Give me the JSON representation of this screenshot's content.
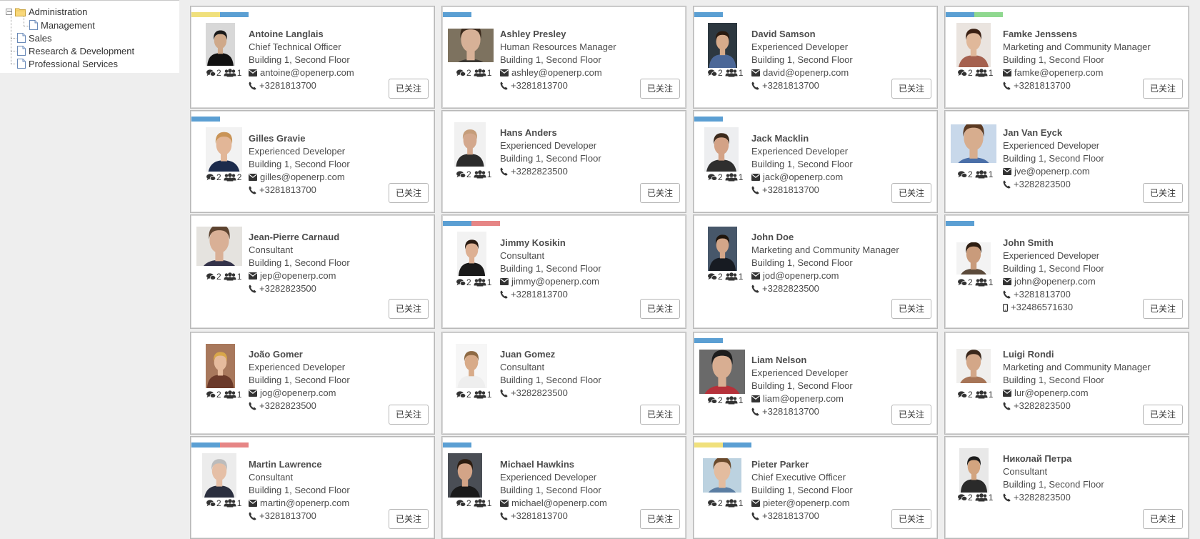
{
  "tree": {
    "root": {
      "label": "Administration",
      "toggle": "−"
    },
    "children": [
      {
        "label": "Management",
        "level": 2
      },
      {
        "label": "Sales",
        "level": 1
      },
      {
        "label": "Research & Development",
        "level": 1
      },
      {
        "label": "Professional Services",
        "level": 1
      }
    ]
  },
  "colors": {
    "tag_yellow": "#f0e07c",
    "tag_blue": "#5b9fd3",
    "tag_green": "#8fd88f",
    "tag_red": "#e68585"
  },
  "follow_label": "已关注",
  "employees": [
    {
      "name": "Antoine Langlais",
      "job": "Chief Technical Officer",
      "location": "Building 1, Second Floor",
      "email": "antoine@openerp.com",
      "phone": "+3281813700",
      "mobile": "",
      "messages": "2",
      "followers": "1",
      "tags": [
        "yellow",
        "blue"
      ]
    },
    {
      "name": "Ashley Presley",
      "job": "Human Resources Manager",
      "location": "Building 1, Second Floor",
      "email": "ashley@openerp.com",
      "phone": "+3281813700",
      "mobile": "",
      "messages": "2",
      "followers": "1",
      "tags": [
        "blue"
      ]
    },
    {
      "name": "David Samson",
      "job": "Experienced Developer",
      "location": "Building 1, Second Floor",
      "email": "david@openerp.com",
      "phone": "+3281813700",
      "mobile": "",
      "messages": "2",
      "followers": "1",
      "tags": [
        "blue"
      ]
    },
    {
      "name": "Famke Jenssens",
      "job": "Marketing and Community Manager",
      "location": "Building 1, Second Floor",
      "email": "famke@openerp.com",
      "phone": "+3281813700",
      "mobile": "",
      "messages": "2",
      "followers": "1",
      "tags": [
        "blue",
        "green"
      ]
    },
    {
      "name": "Gilles Gravie",
      "job": "Experienced Developer",
      "location": "Building 1, Second Floor",
      "email": "gilles@openerp.com",
      "phone": "+3281813700",
      "mobile": "",
      "messages": "2",
      "followers": "2",
      "tags": [
        "blue"
      ]
    },
    {
      "name": "Hans Anders",
      "job": "Experienced Developer",
      "location": "Building 1, Second Floor",
      "email": "",
      "phone": "+3282823500",
      "mobile": "",
      "messages": "2",
      "followers": "1",
      "tags": []
    },
    {
      "name": "Jack Macklin",
      "job": "Experienced Developer",
      "location": "Building 1, Second Floor",
      "email": "jack@openerp.com",
      "phone": "+3281813700",
      "mobile": "",
      "messages": "2",
      "followers": "1",
      "tags": [
        "blue"
      ]
    },
    {
      "name": "Jan Van Eyck",
      "job": "Experienced Developer",
      "location": "Building 1, Second Floor",
      "email": "jve@openerp.com",
      "phone": "+3282823500",
      "mobile": "",
      "messages": "2",
      "followers": "1",
      "tags": []
    },
    {
      "name": "Jean-Pierre Carnaud",
      "job": "Consultant",
      "location": "Building 1, Second Floor",
      "email": "jep@openerp.com",
      "phone": "+3282823500",
      "mobile": "",
      "messages": "2",
      "followers": "1",
      "tags": []
    },
    {
      "name": "Jimmy Kosikin",
      "job": "Consultant",
      "location": "Building 1, Second Floor",
      "email": "jimmy@openerp.com",
      "phone": "+3281813700",
      "mobile": "",
      "messages": "2",
      "followers": "1",
      "tags": [
        "blue",
        "red"
      ]
    },
    {
      "name": "John Doe",
      "job": "Marketing and Community Manager",
      "location": "Building 1, Second Floor",
      "email": "jod@openerp.com",
      "phone": "+3282823500",
      "mobile": "",
      "messages": "2",
      "followers": "1",
      "tags": []
    },
    {
      "name": "John Smith",
      "job": "Experienced Developer",
      "location": "Building 1, Second Floor",
      "email": "john@openerp.com",
      "phone": "+3281813700",
      "mobile": "+32486571630",
      "messages": "2",
      "followers": "1",
      "tags": [
        "blue"
      ]
    },
    {
      "name": "João Gomer",
      "job": "Experienced Developer",
      "location": "Building 1, Second Floor",
      "email": "jog@openerp.com",
      "phone": "+3282823500",
      "mobile": "",
      "messages": "2",
      "followers": "1",
      "tags": []
    },
    {
      "name": "Juan Gomez",
      "job": "Consultant",
      "location": "Building 1, Second Floor",
      "email": "",
      "phone": "+3282823500",
      "mobile": "",
      "messages": "2",
      "followers": "1",
      "tags": []
    },
    {
      "name": "Liam Nelson",
      "job": "Experienced Developer",
      "location": "Building 1, Second Floor",
      "email": "liam@openerp.com",
      "phone": "+3281813700",
      "mobile": "",
      "messages": "2",
      "followers": "1",
      "tags": [
        "blue"
      ]
    },
    {
      "name": "Luigi Rondi",
      "job": "Marketing and Community Manager",
      "location": "Building 1, Second Floor",
      "email": "lur@openerp.com",
      "phone": "+3282823500",
      "mobile": "",
      "messages": "2",
      "followers": "1",
      "tags": []
    },
    {
      "name": "Martin Lawrence",
      "job": "Consultant",
      "location": "Building 1, Second Floor",
      "email": "martin@openerp.com",
      "phone": "+3281813700",
      "mobile": "",
      "messages": "2",
      "followers": "1",
      "tags": [
        "blue",
        "red"
      ]
    },
    {
      "name": "Michael Hawkins",
      "job": "Experienced Developer",
      "location": "Building 1, Second Floor",
      "email": "michael@openerp.com",
      "phone": "+3281813700",
      "mobile": "",
      "messages": "2",
      "followers": "1",
      "tags": [
        "blue"
      ]
    },
    {
      "name": "Pieter Parker",
      "job": "Chief Executive Officer",
      "location": "Building 1, Second Floor",
      "email": "pieter@openerp.com",
      "phone": "+3281813700",
      "mobile": "",
      "messages": "2",
      "followers": "1",
      "tags": [
        "yellow",
        "blue"
      ]
    },
    {
      "name": "Николай Петра",
      "job": "Consultant",
      "location": "Building 1, Second Floor",
      "email": "",
      "phone": "+3282823500",
      "mobile": "",
      "messages": "2",
      "followers": "1",
      "tags": []
    }
  ]
}
